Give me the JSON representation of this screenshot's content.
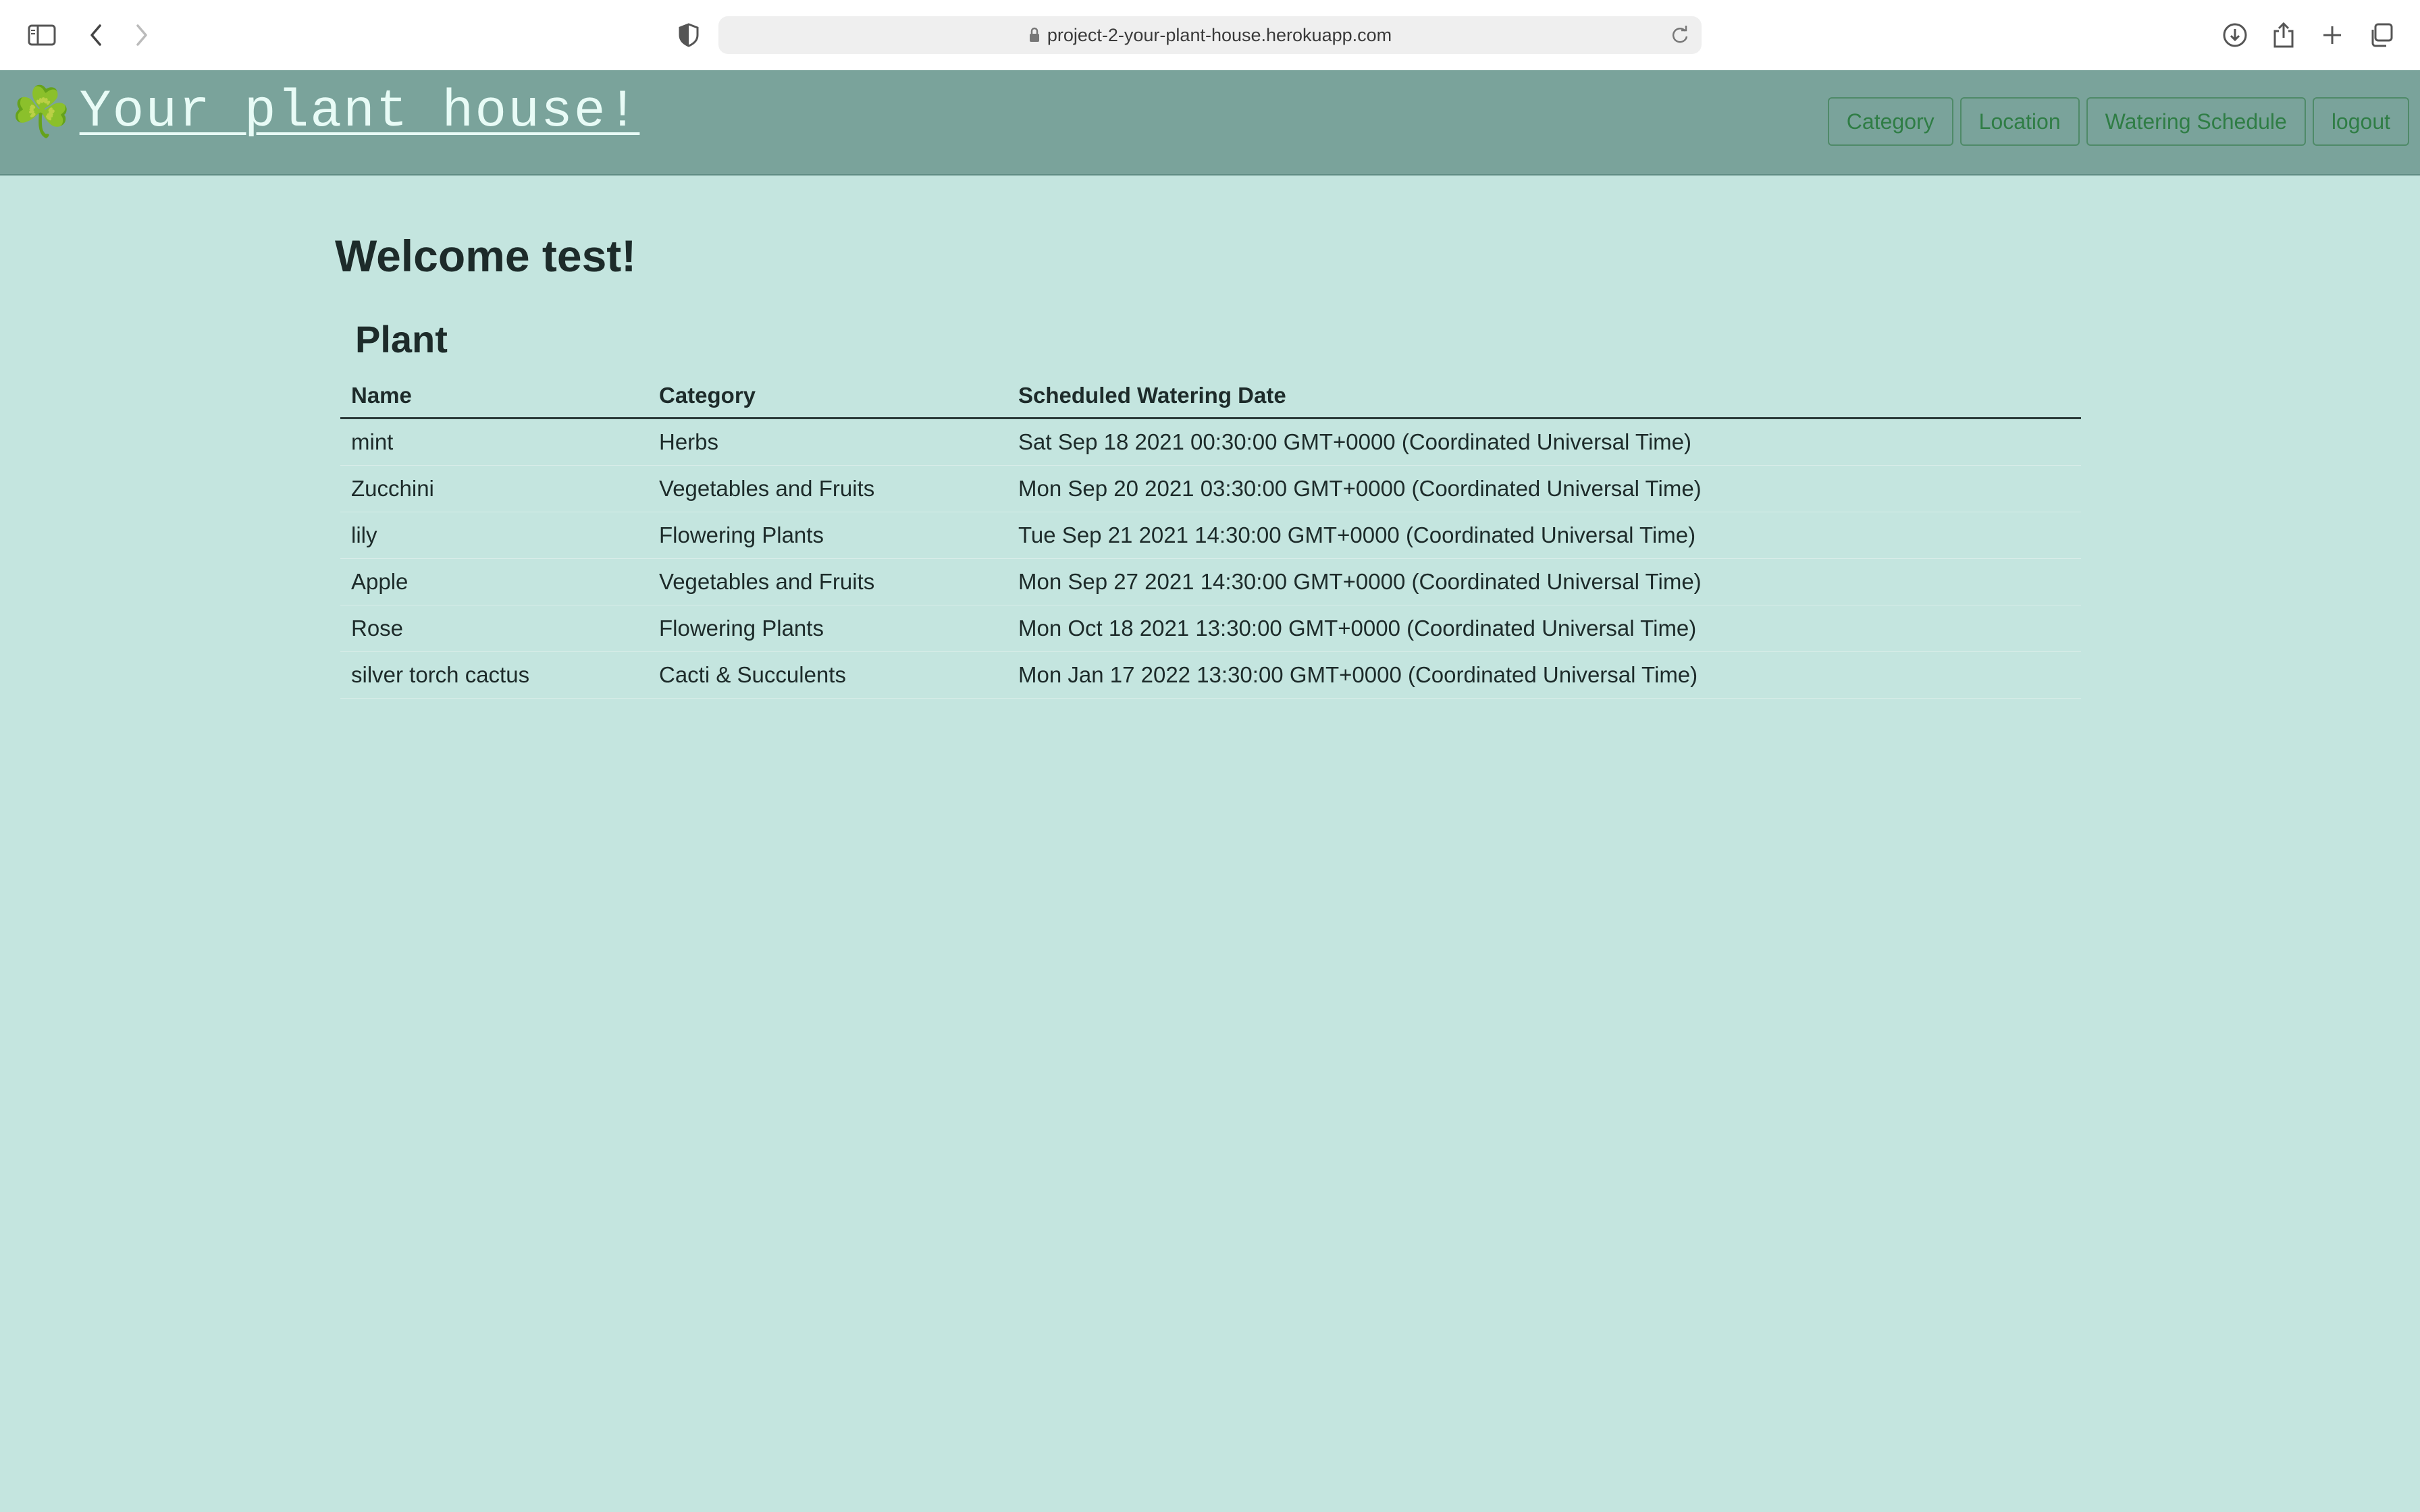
{
  "browser": {
    "url": "project-2-your-plant-house.herokuapp.com",
    "icons": [
      "sidebar-icon",
      "back-icon",
      "forward-icon",
      "privacy-shield-icon",
      "lock-icon",
      "reload-icon",
      "download-icon",
      "share-icon",
      "new-tab-icon",
      "tabs-overview-icon"
    ]
  },
  "header": {
    "brand_icon": "☘️",
    "brand_title": "Your plant house!",
    "nav": {
      "category": "Category",
      "location": "Location",
      "watering_schedule": "Watering Schedule",
      "logout": "logout"
    }
  },
  "main": {
    "welcome": "Welcome test!",
    "section_title": "Plant",
    "table": {
      "headers": [
        "Name",
        "Category",
        "Scheduled Watering Date"
      ],
      "rows": [
        [
          "mint",
          "Herbs",
          "Sat Sep 18 2021 00:30:00 GMT+0000 (Coordinated Universal Time)"
        ],
        [
          "Zucchini",
          "Vegetables and Fruits",
          "Mon Sep 20 2021 03:30:00 GMT+0000 (Coordinated Universal Time)"
        ],
        [
          "lily",
          "Flowering Plants",
          "Tue Sep 21 2021 14:30:00 GMT+0000 (Coordinated Universal Time)"
        ],
        [
          "Apple",
          "Vegetables and Fruits",
          "Mon Sep 27 2021 14:30:00 GMT+0000 (Coordinated Universal Time)"
        ],
        [
          "Rose",
          "Flowering Plants",
          "Mon Oct 18 2021 13:30:00 GMT+0000 (Coordinated Universal Time)"
        ],
        [
          "silver torch cactus",
          "Cacti & Succulents",
          "Mon Jan 17 2022 13:30:00 GMT+0000 (Coordinated Universal Time)"
        ]
      ]
    }
  },
  "colors": {
    "page_bg": "#c4e5df",
    "header_bg": "#7aa39b",
    "nav_text": "#2f7d45"
  }
}
